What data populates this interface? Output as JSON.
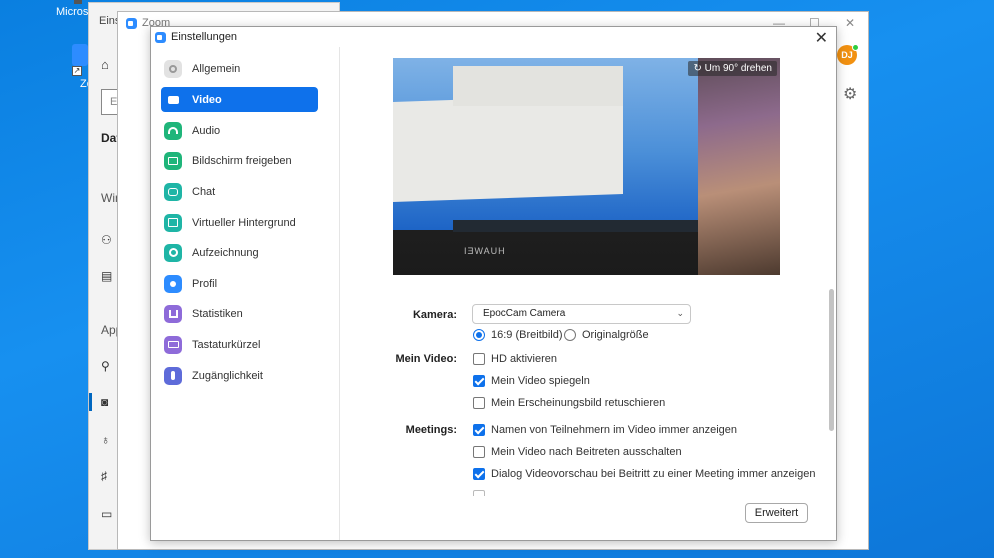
{
  "desktop": {
    "label_top": "Microso",
    "icon_label": "Zo"
  },
  "bg_window": {
    "title": "Einst",
    "search_placeholder": "Ei",
    "section_1": "Dat",
    "section_2": "Win",
    "section_3": "App"
  },
  "zoom_window": {
    "title": "Zoom",
    "avatar_initials": "DJ"
  },
  "settings": {
    "title": "Einstellungen",
    "nav": [
      {
        "label": "Allgemein",
        "icon": "gear-icon",
        "color": "#d9d9d9"
      },
      {
        "label": "Video",
        "icon": "video-icon",
        "color": "#0e71eb"
      },
      {
        "label": "Audio",
        "icon": "headphones-icon",
        "color": "#1fb57a"
      },
      {
        "label": "Bildschirm freigeben",
        "icon": "share-screen-icon",
        "color": "#1fb57a"
      },
      {
        "label": "Chat",
        "icon": "chat-icon",
        "color": "#1fb5a6"
      },
      {
        "label": "Virtueller Hintergrund",
        "icon": "background-icon",
        "color": "#1fb5a6"
      },
      {
        "label": "Aufzeichnung",
        "icon": "record-icon",
        "color": "#1fb5a6"
      },
      {
        "label": "Profil",
        "icon": "profile-icon",
        "color": "#2d8cff"
      },
      {
        "label": "Statistiken",
        "icon": "stats-icon",
        "color": "#8e6bd9"
      },
      {
        "label": "Tastaturkürzel",
        "icon": "keyboard-icon",
        "color": "#8e6bd9"
      },
      {
        "label": "Zugänglichkeit",
        "icon": "accessibility-icon",
        "color": "#5e6bd9"
      }
    ],
    "video": {
      "rotate_label": "Um 90° drehen",
      "preview_brand": "HUAWEI",
      "camera_label": "Kamera:",
      "camera_value": "EpocCam Camera",
      "ratio_options": [
        {
          "label": "16:9 (Breitbild)",
          "selected": true
        },
        {
          "label": "Originalgröße",
          "selected": false
        }
      ],
      "my_video_label": "Mein Video:",
      "my_video_options": [
        {
          "label": "HD aktivieren",
          "checked": false
        },
        {
          "label": "Mein Video spiegeln",
          "checked": true
        },
        {
          "label": "Mein Erscheinungsbild retuschieren",
          "checked": false
        }
      ],
      "meetings_label": "Meetings:",
      "meetings_options": [
        {
          "label": "Namen von Teilnehmern im Video immer anzeigen",
          "checked": true
        },
        {
          "label": "Mein Video nach Beitreten ausschalten",
          "checked": false
        },
        {
          "label": "Dialog Videovorschau bei Beitritt zu einer Meeting immer anzeigen",
          "checked": true
        }
      ],
      "advanced_button": "Erweitert"
    }
  },
  "colors": {
    "accent": "#0e71eb",
    "desktop": "#1790f0"
  }
}
